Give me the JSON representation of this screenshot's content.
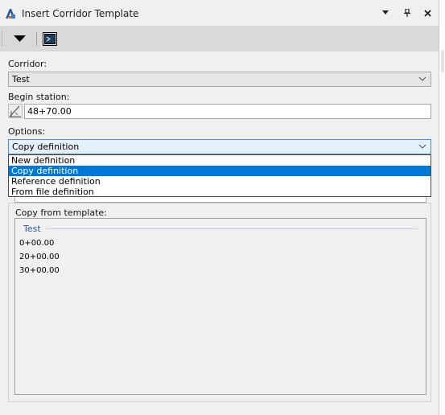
{
  "window": {
    "title": "Insert Corridor Template"
  },
  "titlebar_buttons": [
    "menu-caret-icon",
    "pin-icon",
    "close-icon"
  ],
  "toolbar": {
    "buttons": [
      "dropdown-triangle-icon",
      "view-window-icon"
    ]
  },
  "corridor": {
    "label": "Corridor:",
    "value": "Test"
  },
  "begin_station": {
    "label": "Begin station:",
    "value": "48+70.00",
    "icon": "station-pick-icon"
  },
  "options": {
    "label": "Options:",
    "selected": "Copy definition",
    "items": [
      "New definition",
      "Copy definition",
      "Reference definition",
      "From file definition"
    ],
    "selected_index": 1
  },
  "copy_from": {
    "label": "Copy from template:",
    "group_name": "Test",
    "items": [
      "0+00.00",
      "20+00.00",
      "30+00.00"
    ]
  },
  "colors": {
    "selection": "#0078d7",
    "focus_border": "#4a8bd0",
    "toolbar_bg": "#d9d9d9",
    "group_header": "#2a56a8"
  }
}
